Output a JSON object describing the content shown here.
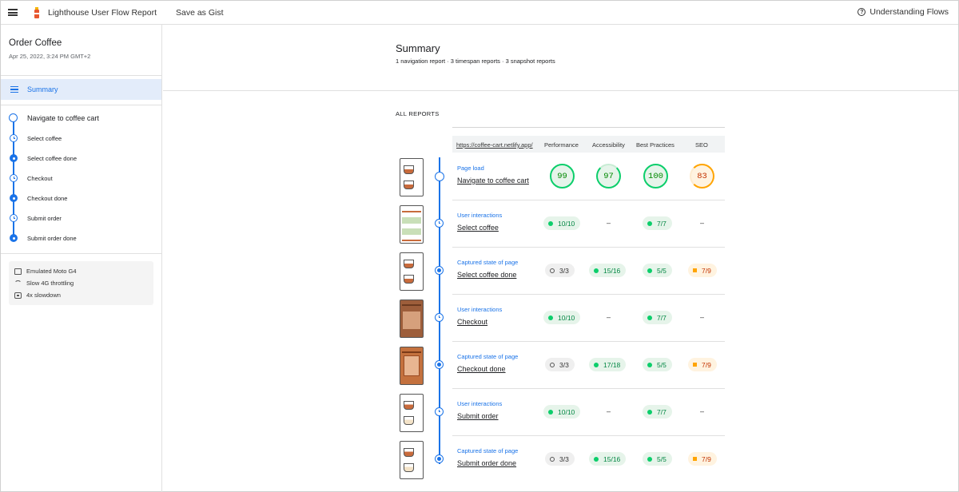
{
  "topbar": {
    "title": "Lighthouse User Flow Report",
    "save_gist": "Save as Gist",
    "help": "Understanding Flows"
  },
  "sidebar": {
    "flow_name": "Order Coffee",
    "date": "Apr 25, 2022, 3:24 PM GMT+2",
    "summary_label": "Summary",
    "steps": [
      {
        "label": "Navigate to coffee cart",
        "mode": "navigation"
      },
      {
        "label": "Select coffee",
        "mode": "timespan"
      },
      {
        "label": "Select coffee done",
        "mode": "snapshot"
      },
      {
        "label": "Checkout",
        "mode": "timespan"
      },
      {
        "label": "Checkout done",
        "mode": "snapshot"
      },
      {
        "label": "Submit order",
        "mode": "timespan"
      },
      {
        "label": "Submit order done",
        "mode": "snapshot"
      }
    ],
    "env": [
      "Emulated Moto G4",
      "Slow 4G throttling",
      "4x slowdown"
    ]
  },
  "summary": {
    "title": "Summary",
    "subtitle": "1 navigation report · 3 timespan reports · 3 snapshot reports",
    "all_reports": "ALL REPORTS",
    "url": "https://coffee-cart.netlify.app/",
    "columns": [
      "Performance",
      "Accessibility",
      "Best Practices",
      "SEO"
    ],
    "rows": [
      {
        "mode": "Page load",
        "name": "Navigate to coffee cart",
        "scores": [
          "99",
          "97",
          "100",
          "83"
        ]
      },
      {
        "mode": "User interactions",
        "name": "Select coffee",
        "scores": [
          "10/10",
          "–",
          "7/7",
          "–"
        ]
      },
      {
        "mode": "Captured state of page",
        "name": "Select coffee done",
        "scores": [
          "3/3",
          "15/16",
          "5/5",
          "7/9"
        ]
      },
      {
        "mode": "User interactions",
        "name": "Checkout",
        "scores": [
          "10/10",
          "–",
          "7/7",
          "–"
        ]
      },
      {
        "mode": "Captured state of page",
        "name": "Checkout done",
        "scores": [
          "3/3",
          "17/18",
          "5/5",
          "7/9"
        ]
      },
      {
        "mode": "User interactions",
        "name": "Submit order",
        "scores": [
          "10/10",
          "–",
          "7/7",
          "–"
        ]
      },
      {
        "mode": "Captured state of page",
        "name": "Submit order done",
        "scores": [
          "3/3",
          "15/16",
          "5/5",
          "7/9"
        ]
      }
    ]
  },
  "colors": {
    "accent": "#1a73e8",
    "pass": "#0cce6b",
    "average": "#ffa400"
  }
}
